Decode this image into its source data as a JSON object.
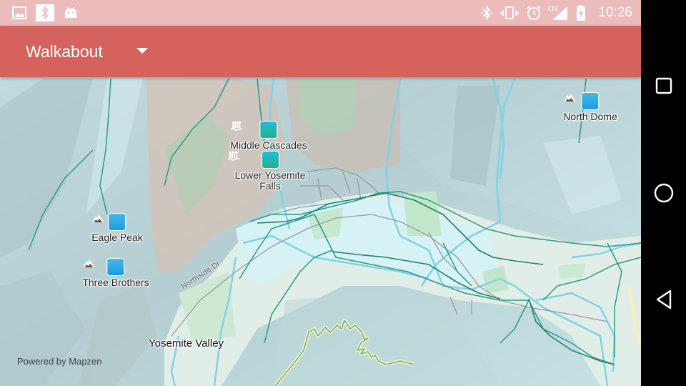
{
  "status_bar": {
    "left_icons": [
      "image-notification-icon",
      "bluetooth-notification-icon",
      "android-notification-icon"
    ],
    "right_icons": [
      "bluetooth-icon",
      "vibrate-icon",
      "alarm-icon",
      "lte-signal-icon",
      "battery-charging-icon"
    ],
    "lte_label": "LTE",
    "time": "10:26"
  },
  "app_bar": {
    "title": "Walkabout",
    "background": "#d5625d",
    "dropdown_icon": "triangle-down-icon"
  },
  "map": {
    "pois": [
      {
        "name": "North Dome",
        "type": "peak"
      },
      {
        "name": "Middle Cascades",
        "type": "waterfall"
      },
      {
        "name": "Lower Yosemite Falls",
        "type": "waterfall"
      },
      {
        "name": "Eagle Peak",
        "type": "peak"
      },
      {
        "name": "Three Brothers",
        "type": "peak"
      }
    ],
    "place_label": "Yosemite Valley",
    "road_label": "Northside Dr",
    "attribution": "Powered by Mapzen",
    "colors": {
      "water": "#7fd3e6",
      "trail": "#2b9a87",
      "road": "#9a9a9a",
      "park": "#bfe6cc",
      "valley": "#d8f0f2"
    }
  },
  "nav_bar": {
    "buttons": [
      "recents-button",
      "home-button",
      "back-button"
    ]
  }
}
